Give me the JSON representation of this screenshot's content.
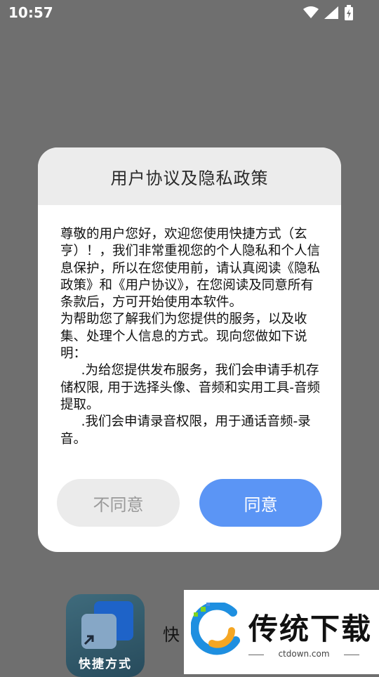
{
  "status_bar": {
    "time": "10:57"
  },
  "dialog": {
    "title": "用户协议及隐私政策",
    "paragraphs": [
      "尊敬的用户您好，欢迎您使用快捷方式（玄亨）！，我们非常重视您的个人隐私和个人信息保护，所以在您使用前，请认真阅读《隐私政策》和《用户协议》，在您阅读及同意所有条款后，方可开始使用本软件。",
      "为帮助您了解我们为您提供的服务，以及收集、处理个人信息的方式。现向您做如下说明：",
      ".为给您提供发布服务，我们会申请手机存储权限, 用于选择头像、音频和实用工具-音频提取。",
      ".我们会申请录音权限，用于通话音频-录音。"
    ],
    "disagree_label": "不同意",
    "agree_label": "同意"
  },
  "background_app": {
    "icon_label": "快捷方式",
    "name_peek": "快"
  },
  "watermark": {
    "text": "传统下载",
    "url": "ctdown.com"
  },
  "colors": {
    "overlay": "#6f6f6f",
    "agree_button": "#5b95f5",
    "disagree_button": "#ebebeb"
  }
}
